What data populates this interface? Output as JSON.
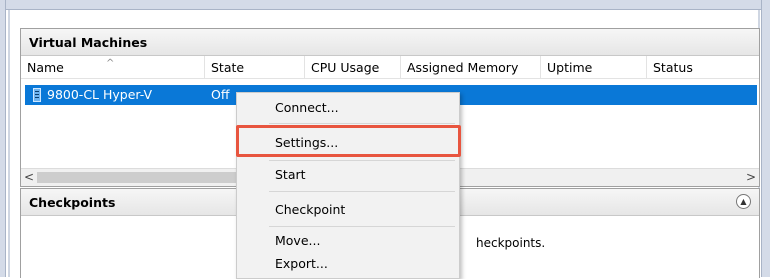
{
  "vm_panel": {
    "title": "Virtual Machines",
    "columns": [
      "Name",
      "State",
      "CPU Usage",
      "Assigned Memory",
      "Uptime",
      "Status"
    ],
    "sort_indicator": "^",
    "rows": [
      {
        "name": "9800-CL Hyper-V",
        "state": "Off"
      }
    ],
    "scroll_left": "<",
    "scroll_right": ">"
  },
  "checkpoints_panel": {
    "title": "Checkpoints",
    "collapse_glyph": "▲",
    "message_fragment": "heckpoints."
  },
  "context_menu": {
    "items": [
      "Connect...",
      "Settings...",
      "Start",
      "Checkpoint",
      "Move...",
      "Export..."
    ],
    "highlighted_item": "Settings...",
    "highlight_color": "#e8553f"
  },
  "colors": {
    "selection": "#0a78d7"
  }
}
